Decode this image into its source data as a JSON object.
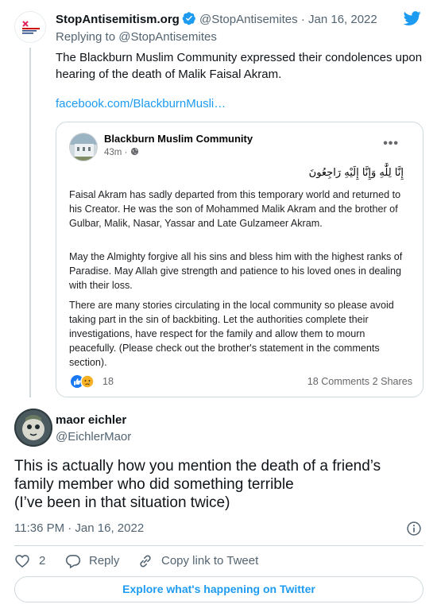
{
  "parent_tweet": {
    "display_name": "StopAntisemitism.org",
    "handle": "@StopAntisemites",
    "separator": "·",
    "date": "Jan 16, 2022",
    "replying_prefix": "Replying to",
    "replying_to": "@StopAntisemites",
    "text": "The Blackburn Muslim Community expressed their condolences upon hearing of the death of Malik Faisal Akram.",
    "link": "facebook.com/BlackburnMusli…"
  },
  "fb_card": {
    "page_name": "Blackburn Muslim Community",
    "time": "43m ·",
    "menu": "•••",
    "arabic_line": "إِنَّا لِلَّٰهِ وَإِنَّا إِلَيْهِ رَاجِعُونَ",
    "paragraphs": [
      "Faisal Akram has sadly departed from this temporary world and returned to his Creator. He was the son of Mohammed Malik Akram and the brother of Gulbar, Malik, Nasar, Yassar and Late Gulzameer Akram.",
      "May the Almighty forgive all his sins and bless him with the highest ranks of Paradise. May Allah give strength and patience to his loved ones in dealing with their loss.",
      "There are many stories circulating in the local community so please avoid taking part in the sin of backbiting. Let the authorities complete their investigations, have respect for the family and allow them to mourn peacefully. (Please check out the brother's statement in the comments section)."
    ],
    "reaction_count": "18",
    "stats": "18 Comments  2 Shares"
  },
  "main_tweet": {
    "display_name": "maor eichler",
    "handle": "@EichlerMaor",
    "lines": [
      "This is actually how you mention the death of a friend’s",
      "family member who did something terrible",
      "(I’ve been in that situation twice)"
    ],
    "timestamp": "11:36 PM · Jan 16, 2022"
  },
  "actions": {
    "like_count": "2",
    "reply_label": "Reply",
    "copy_label": "Copy link to Tweet"
  },
  "explore_label": "Explore what's happening on Twitter",
  "colors": {
    "accent": "#1d9bf0",
    "text": "#0f1419",
    "secondary": "#536471",
    "border": "#cfd9de"
  }
}
